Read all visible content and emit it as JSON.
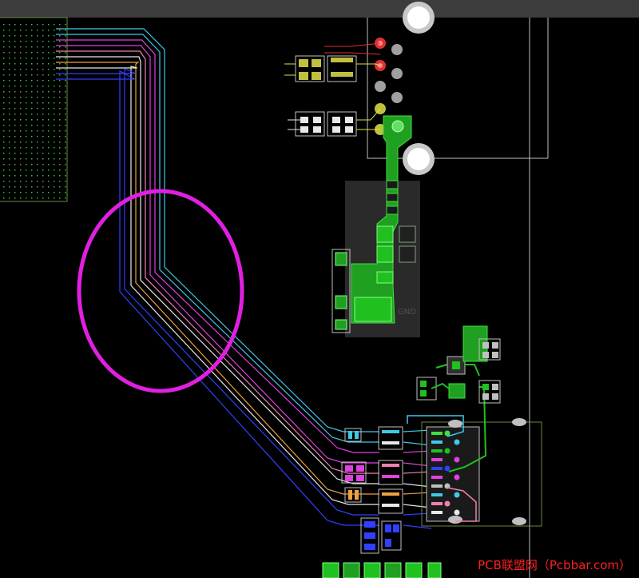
{
  "watermark": "PCB联盟网（Pcbbar.com）",
  "copper_label": "GND",
  "colors": {
    "background": "#000000",
    "toolbar": "#3c3c3c",
    "highlight_circle": "#e020e0",
    "trace_cyan": "#40c8e8",
    "trace_magenta": "#e040e0",
    "trace_pink": "#f080b0",
    "trace_orange": "#f0a040",
    "trace_white": "#e8e8e8",
    "trace_blue": "#3040ff",
    "copper_green": "#20c020",
    "silkscreen": "#c0c0c0",
    "pad_yellow": "#e0e040",
    "pad_red": "#e03030",
    "watermark": "#ff2020"
  }
}
